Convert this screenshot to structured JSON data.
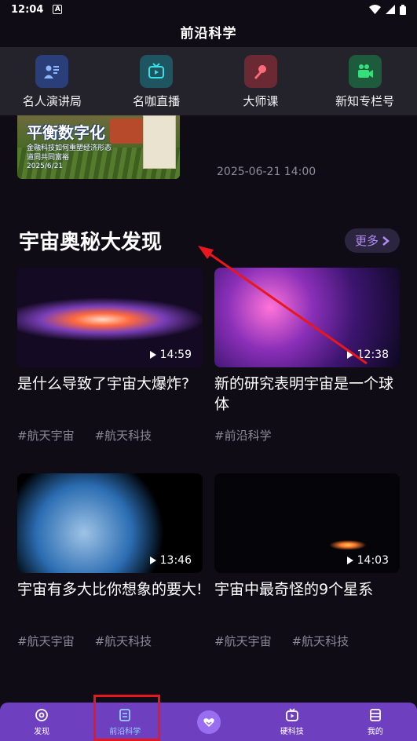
{
  "status_bar": {
    "time": "12:04",
    "notification_icon": "A"
  },
  "app": {
    "title": "前沿科学"
  },
  "categories": [
    {
      "label": "名人演讲局",
      "icon": "speaker-icon",
      "bg": "#2a3f7a",
      "fg": "#8fb7ff"
    },
    {
      "label": "名咖直播",
      "icon": "tv-icon",
      "bg": "#1f5560",
      "fg": "#39e0e8"
    },
    {
      "label": "大师课",
      "icon": "microphone-icon",
      "bg": "#6b2a33",
      "fg": "#ff6b7a"
    },
    {
      "label": "新知专栏号",
      "icon": "video-camera-icon",
      "bg": "#1e5a3c",
      "fg": "#35e07a"
    }
  ],
  "previous_card": {
    "image_headline": "平衡数字化",
    "image_sub_line1": "金融科技如何重塑经济形态",
    "image_sub_line2": "道同共同富裕",
    "image_date": "2025/6/21",
    "date": "2025-06-21 14:00"
  },
  "section": {
    "title": "宇宙奥秘大发现",
    "more_label": "更多"
  },
  "videos": [
    {
      "duration": "14:59",
      "title": "是什么导致了宇宙大爆炸?",
      "tags": [
        "#航天宇宙",
        "#航天科技"
      ]
    },
    {
      "duration": "12:38",
      "title": "新的研究表明宇宙是一个球体",
      "tags": [
        "#前沿科学"
      ]
    },
    {
      "duration": "13:46",
      "title": "宇宙有多大比你想象的要大!",
      "tags": [
        "#航天宇宙",
        "#航天科技"
      ]
    },
    {
      "duration": "14:03",
      "title": "宇宙中最奇怪的9个星系",
      "tags": [
        "#航天宇宙",
        "#航天科技"
      ]
    }
  ],
  "bottom_nav": {
    "items": [
      {
        "label": "发现",
        "icon": "discover-icon"
      },
      {
        "label": "前沿科学",
        "icon": "document-icon",
        "active": true
      },
      {
        "label": "",
        "icon": "favorite-heart-icon"
      },
      {
        "label": "硬科技",
        "icon": "tv-play-icon"
      },
      {
        "label": "我的",
        "icon": "profile-icon"
      }
    ]
  },
  "colors": {
    "accent": "#6e3fbf",
    "more_text": "#b58cf5",
    "annotation": "#e8171d"
  }
}
